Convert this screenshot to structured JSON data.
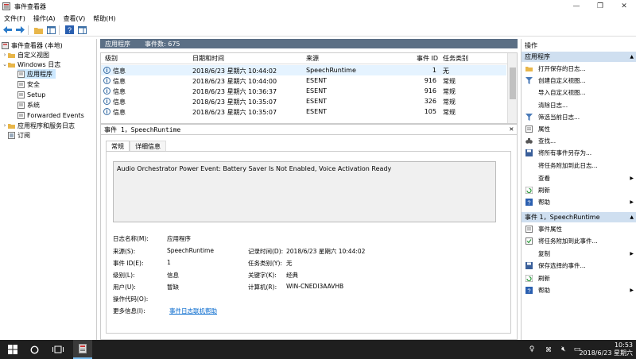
{
  "window": {
    "title": "事件查看器"
  },
  "menu": [
    "文件(F)",
    "操作(A)",
    "查看(V)",
    "帮助(H)"
  ],
  "tree": {
    "root": "事件查看器 (本地)",
    "custom_views": "自定义视图",
    "windows_logs": "Windows 日志",
    "logs": [
      "应用程序",
      "安全",
      "Setup",
      "系统",
      "Forwarded Events"
    ],
    "app_service_logs": "应用程序和服务日志",
    "subscriptions": "订阅"
  },
  "log_header": {
    "name": "应用程序",
    "count_label": "事件数: 675"
  },
  "grid": {
    "columns": [
      "级别",
      "日期和时间",
      "来源",
      "事件 ID",
      "任务类别"
    ],
    "rows": [
      {
        "level": "信息",
        "date": "2018/6/23 星期六 10:44:02",
        "source": "SpeechRuntime",
        "id": "1",
        "task": "无"
      },
      {
        "level": "信息",
        "date": "2018/6/23 星期六 10:44:00",
        "source": "ESENT",
        "id": "916",
        "task": "常规"
      },
      {
        "level": "信息",
        "date": "2018/6/23 星期六 10:36:37",
        "source": "ESENT",
        "id": "916",
        "task": "常规"
      },
      {
        "level": "信息",
        "date": "2018/6/23 星期六 10:35:07",
        "source": "ESENT",
        "id": "326",
        "task": "常规"
      },
      {
        "level": "信息",
        "date": "2018/6/23 星期六 10:35:07",
        "source": "ESENT",
        "id": "105",
        "task": "常规"
      }
    ]
  },
  "detail": {
    "title": "事件 1，SpeechRuntime",
    "tabs": [
      "常规",
      "详细信息"
    ],
    "message": "Audio Orchestrator Power Event: Battery Saver Is Not Enabled, Voice Activation Ready",
    "fields": {
      "log_name_label": "日志名称(M):",
      "log_name": "应用程序",
      "source_label": "来源(S):",
      "source": "SpeechRuntime",
      "logged_label": "记录时间(D):",
      "logged": "2018/6/23 星期六 10:44:02",
      "event_id_label": "事件 ID(E):",
      "event_id": "1",
      "task_label": "任务类别(Y):",
      "task": "无",
      "level_label": "级别(L):",
      "level": "信息",
      "keywords_label": "关键字(K):",
      "keywords": "经典",
      "user_label": "用户(U):",
      "user": "暂缺",
      "computer_label": "计算机(R):",
      "computer": "WIN-CNEDI3AAVHB",
      "opcode_label": "操作代码(O):",
      "more_info_label": "更多信息(I):",
      "more_info_link": "事件日志联机帮助"
    }
  },
  "actions": {
    "header": "操作",
    "section1": "应用程序",
    "items1": [
      "打开保存的日志...",
      "创建自定义视图...",
      "导入自定义视图...",
      "清除日志...",
      "筛选当前日志...",
      "属性",
      "查找...",
      "将所有事件另存为...",
      "将任务附加到此日志...",
      "查看",
      "刷新",
      "帮助"
    ],
    "section2": "事件 1，SpeechRuntime",
    "items2": [
      "事件属性",
      "将任务附加到此事件...",
      "复制",
      "保存选择的事件...",
      "刷新",
      "帮助"
    ]
  },
  "taskbar": {
    "time": "10:53",
    "date": "2018/6/23 星期六"
  },
  "colors": {
    "accent": "#5b6f85",
    "selection": "#cce8ff",
    "section": "#cfdff0",
    "taskbar": "#1f1f1f"
  }
}
